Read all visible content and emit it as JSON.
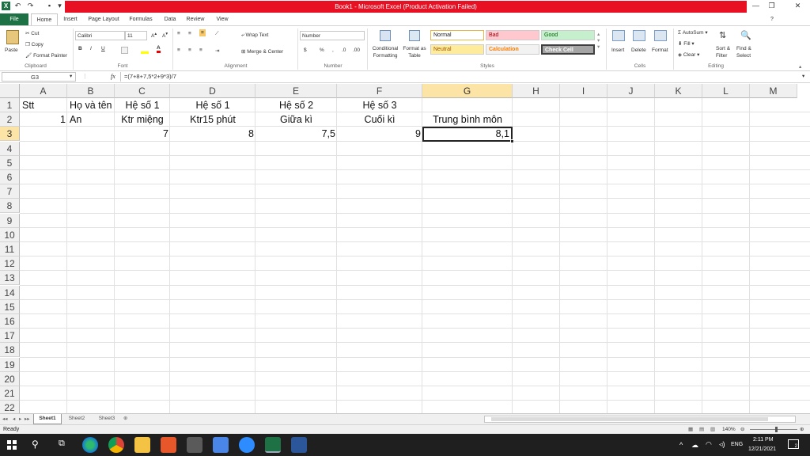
{
  "window": {
    "title": "Book1 - Microsoft Excel (Product Activation Failed)"
  },
  "tabs": [
    "File",
    "Home",
    "Insert",
    "Page Layout",
    "Formulas",
    "Data",
    "Review",
    "View"
  ],
  "ribbon": {
    "clipboard": {
      "paste": "Paste",
      "cut": "Cut",
      "copy": "Copy",
      "format_painter": "Format Painter",
      "label": "Clipboard"
    },
    "font": {
      "name": "Calibri",
      "size": "11",
      "label": "Font",
      "bold": "B",
      "italic": "I",
      "underline": "U"
    },
    "alignment": {
      "wrap": "Wrap Text",
      "merge": "Merge & Center",
      "label": "Alignment"
    },
    "number": {
      "format": "Number",
      "currency": "$",
      "percent": "%",
      "comma": ",",
      "label": "Number"
    },
    "styles": {
      "conditional": "Conditional\nFormatting",
      "format_table": "Format as\nTable",
      "normal": "Normal",
      "bad": "Bad",
      "good": "Good",
      "neutral": "Neutral",
      "calculation": "Calculation",
      "check_cell": "Check Cell",
      "label": "Styles"
    },
    "cells": {
      "insert": "Insert",
      "delete": "Delete",
      "format": "Format",
      "label": "Cells"
    },
    "editing": {
      "autosum": "AutoSum",
      "fill": "Fill",
      "clear": "Clear",
      "sort": "Sort &\nFilter",
      "find": "Find &\nSelect",
      "label": "Editing"
    }
  },
  "formula_bar": {
    "name_box": "G3",
    "fx": "fx",
    "formula": "=(7+8+7,5*2+9*3)/7"
  },
  "columns": [
    "A",
    "B",
    "C",
    "D",
    "E",
    "F",
    "G",
    "H",
    "I",
    "J",
    "K",
    "L",
    "M"
  ],
  "rows": [
    "1",
    "2",
    "3",
    "4",
    "5",
    "6",
    "7",
    "8",
    "9",
    "10",
    "11",
    "12",
    "13",
    "14",
    "15",
    "16",
    "17",
    "18",
    "19",
    "20",
    "21",
    "22"
  ],
  "cells": {
    "A1": "Stt",
    "B1": "Họ và tên",
    "C1": "Hệ số  1",
    "D1": "Hệ số 1",
    "E1": "Hệ số 2",
    "F1": "Hệ số 3",
    "A2": "1",
    "B2": "An",
    "C2": "Ktr miệng",
    "D2": "Ktr15 phút",
    "E2": "Giữa kì",
    "F2": "Cuối kì",
    "G2": "Trung bình môn",
    "C3": "7",
    "D3": "8",
    "E3": "7,5",
    "F3": "9",
    "G3": "8,1"
  },
  "sheets": [
    "Sheet1",
    "Sheet2",
    "Sheet3"
  ],
  "status": {
    "text": "Ready",
    "zoom": "140%"
  },
  "taskbar": {
    "lang": "ENG",
    "time": "2:11 PM",
    "date": "12/21/2021",
    "notif": "2"
  },
  "colors": {
    "excel_green": "#1e7145",
    "title_red": "#e81123",
    "selected_header": "#fce4a6"
  }
}
